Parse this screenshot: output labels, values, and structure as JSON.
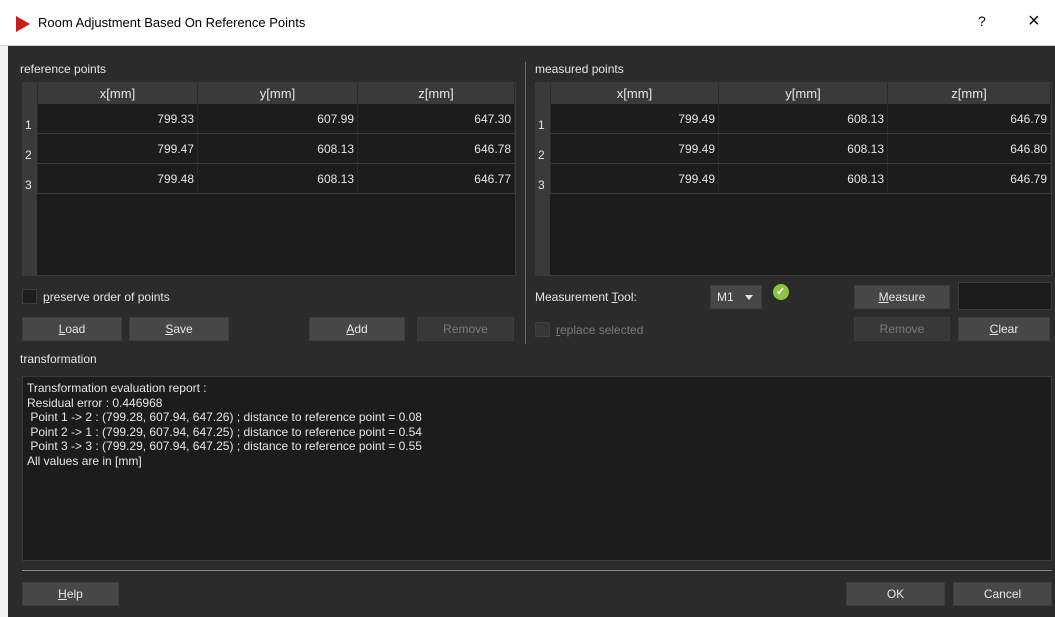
{
  "window": {
    "title": "Room Adjustment Based On Reference Points",
    "help": "?",
    "close": "×"
  },
  "reference": {
    "label": "reference points",
    "columns": [
      "x[mm]",
      "y[mm]",
      "z[mm]"
    ],
    "rows": [
      {
        "idx": "1",
        "x": "799.33",
        "y": "607.99",
        "z": "647.30"
      },
      {
        "idx": "2",
        "x": "799.47",
        "y": "608.13",
        "z": "646.78"
      },
      {
        "idx": "3",
        "x": "799.48",
        "y": "608.13",
        "z": "646.77"
      }
    ],
    "preserve_order": {
      "pre": "",
      "ul": "p",
      "post": "reserve order of points"
    },
    "buttons": {
      "load": {
        "ul": "L",
        "post": "oad"
      },
      "save": {
        "ul": "S",
        "post": "ave"
      },
      "add": {
        "ul": "A",
        "post": "dd"
      },
      "remove": "Remove"
    }
  },
  "measured": {
    "label": "measured points",
    "columns": [
      "x[mm]",
      "y[mm]",
      "z[mm]"
    ],
    "rows": [
      {
        "idx": "1",
        "x": "799.49",
        "y": "608.13",
        "z": "646.79"
      },
      {
        "idx": "2",
        "x": "799.49",
        "y": "608.13",
        "z": "646.80"
      },
      {
        "idx": "3",
        "x": "799.49",
        "y": "608.13",
        "z": "646.79"
      }
    ],
    "tool_label": {
      "pre": "Measurement ",
      "ul": "T",
      "post": "ool:"
    },
    "tool_value": "M1",
    "replace_selected": {
      "ul": "r",
      "post": "eplace selected"
    },
    "buttons": {
      "measure": {
        "ul": "M",
        "post": "easure"
      },
      "remove": "Remove",
      "clear": {
        "ul": "C",
        "post": "lear"
      }
    }
  },
  "transformation": {
    "label": "transformation",
    "report": "Transformation evaluation report :\nResidual error : 0.446968\n Point 1 -> 2 : (799.28, 607.94, 647.26) ; distance to reference point = 0.08\n Point 2 -> 1 : (799.29, 607.94, 647.25) ; distance to reference point = 0.54\n Point 3 -> 3 : (799.29, 607.94, 647.25) ; distance to reference point = 0.55\nAll values are in [mm]"
  },
  "footer": {
    "help": {
      "ul": "H",
      "post": "elp"
    },
    "ok": "OK",
    "cancel": "Cancel"
  },
  "colors": {
    "background": "#2b2b2b",
    "grid": "#1c1c1c",
    "button": "#474747",
    "accent_logo": "#c8201c",
    "status_ok": "#8cc63f"
  },
  "icons": {
    "logo": "app-logo-icon",
    "status": "check-circle-icon"
  }
}
